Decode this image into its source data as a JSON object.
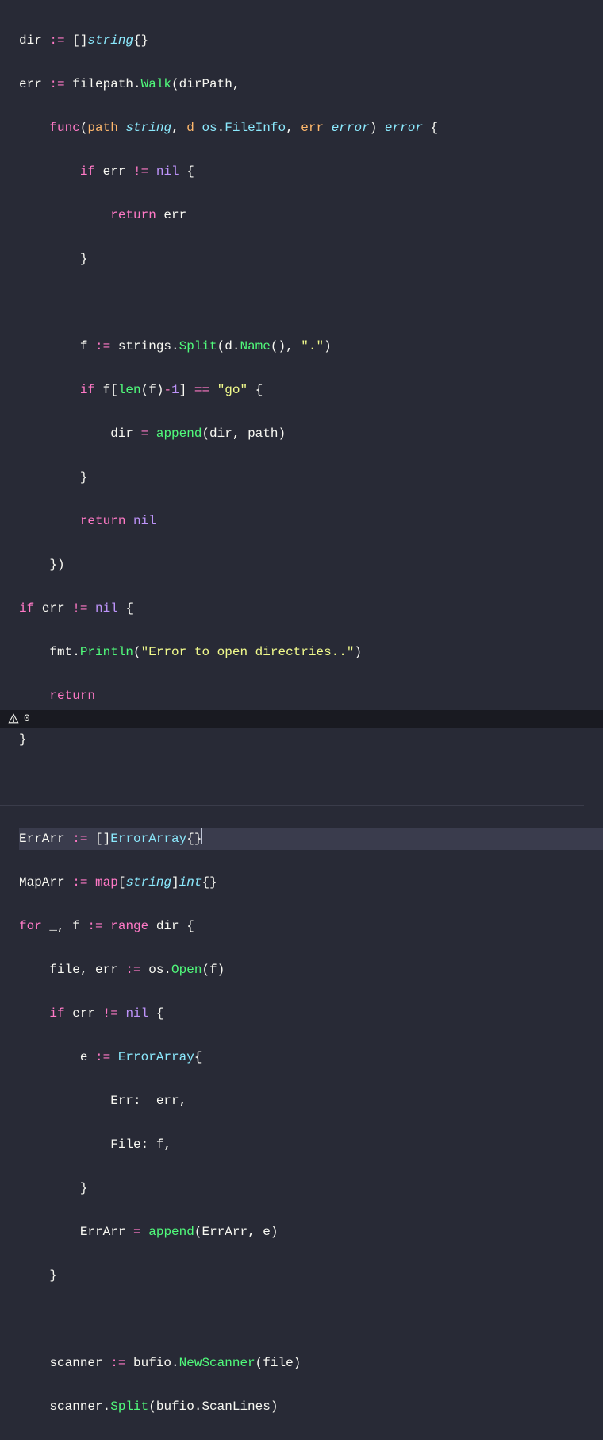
{
  "code": {
    "l1": {
      "a": "dir ",
      "b": ":=",
      "c": " []",
      "d": "string",
      "e": "{}"
    },
    "l2": {
      "a": "err ",
      "b": ":=",
      "c": " filepath.",
      "d": "Walk",
      "e": "(dirPath,"
    },
    "l3": {
      "a": "    ",
      "b": "func",
      "c": "(",
      "d": "path ",
      "e": "string",
      "f": ", ",
      "g": "d ",
      "h": "os",
      "i": ".",
      "j": "FileInfo",
      "k": ", ",
      "l": "err ",
      "m": "error",
      "n": ") ",
      "o": "error",
      "p": " {"
    },
    "l4": {
      "a": "        ",
      "b": "if",
      "c": " err ",
      "d": "!=",
      "e": " ",
      "f": "nil",
      "g": " {"
    },
    "l5": {
      "a": "            ",
      "b": "return",
      "c": " err"
    },
    "l6": {
      "a": "        }"
    },
    "l7": {
      "a": ""
    },
    "l8": {
      "a": "        f ",
      "b": ":=",
      "c": " strings.",
      "d": "Split",
      "e": "(d.",
      "f": "Name",
      "g": "(), ",
      "h": "\".\"",
      "i": ")"
    },
    "l9": {
      "a": "        ",
      "b": "if",
      "c": " f[",
      "d": "len",
      "e": "(f)",
      "f": "-",
      "g": "1",
      "h": "] ",
      "i": "==",
      "j": " ",
      "k": "\"go\"",
      "l": " {"
    },
    "l10": {
      "a": "            dir ",
      "b": "=",
      "c": " ",
      "d": "append",
      "e": "(dir, path)"
    },
    "l11": {
      "a": "        }"
    },
    "l12": {
      "a": "        ",
      "b": "return",
      "c": " ",
      "d": "nil"
    },
    "l13": {
      "a": "    })"
    },
    "l14": {
      "a": "",
      "b": "if",
      "c": " err ",
      "d": "!=",
      "e": " ",
      "f": "nil",
      "g": " {"
    },
    "l15": {
      "a": "    fmt.",
      "b": "Println",
      "c": "(",
      "d": "\"Error to open directries..\"",
      "e": ")"
    },
    "l16": {
      "a": "    ",
      "b": "return"
    },
    "l17": {
      "a": "}"
    },
    "l18": {
      "a": "ErrArr ",
      "b": ":=",
      "c": " []",
      "d": "ErrorArray",
      "e": "{}"
    },
    "l19": {
      "a": "MapArr ",
      "b": ":=",
      "c": " ",
      "d": "map",
      "e": "[",
      "f": "string",
      "g": "]",
      "h": "int",
      "i": "{}"
    },
    "l20": {
      "a": "",
      "b": "for",
      "c": " _, f ",
      "d": ":=",
      "e": " ",
      "f": "range",
      "g": " dir {"
    },
    "l21": {
      "a": "    file, err ",
      "b": ":=",
      "c": " os.",
      "d": "Open",
      "e": "(f)"
    },
    "l22": {
      "a": "    ",
      "b": "if",
      "c": " err ",
      "d": "!=",
      "e": " ",
      "f": "nil",
      "g": " {"
    },
    "l23": {
      "a": "        e ",
      "b": ":=",
      "c": " ",
      "d": "ErrorArray",
      "e": "{"
    },
    "l24": {
      "a": "            Err:  err,"
    },
    "l25": {
      "a": "            File: f,"
    },
    "l26": {
      "a": "        }"
    },
    "l27": {
      "a": "        ErrArr ",
      "b": "=",
      "c": " ",
      "d": "append",
      "e": "(ErrArr, e)"
    },
    "l28": {
      "a": "    }"
    },
    "l29": {
      "a": ""
    },
    "l30": {
      "a": "    scanner ",
      "b": ":=",
      "c": " bufio.",
      "d": "NewScanner",
      "e": "(file)"
    },
    "l31": {
      "a": "    scanner.",
      "b": "Split",
      "c": "(bufio.ScanLines)"
    }
  },
  "statusbar": {
    "warnings": "0"
  }
}
